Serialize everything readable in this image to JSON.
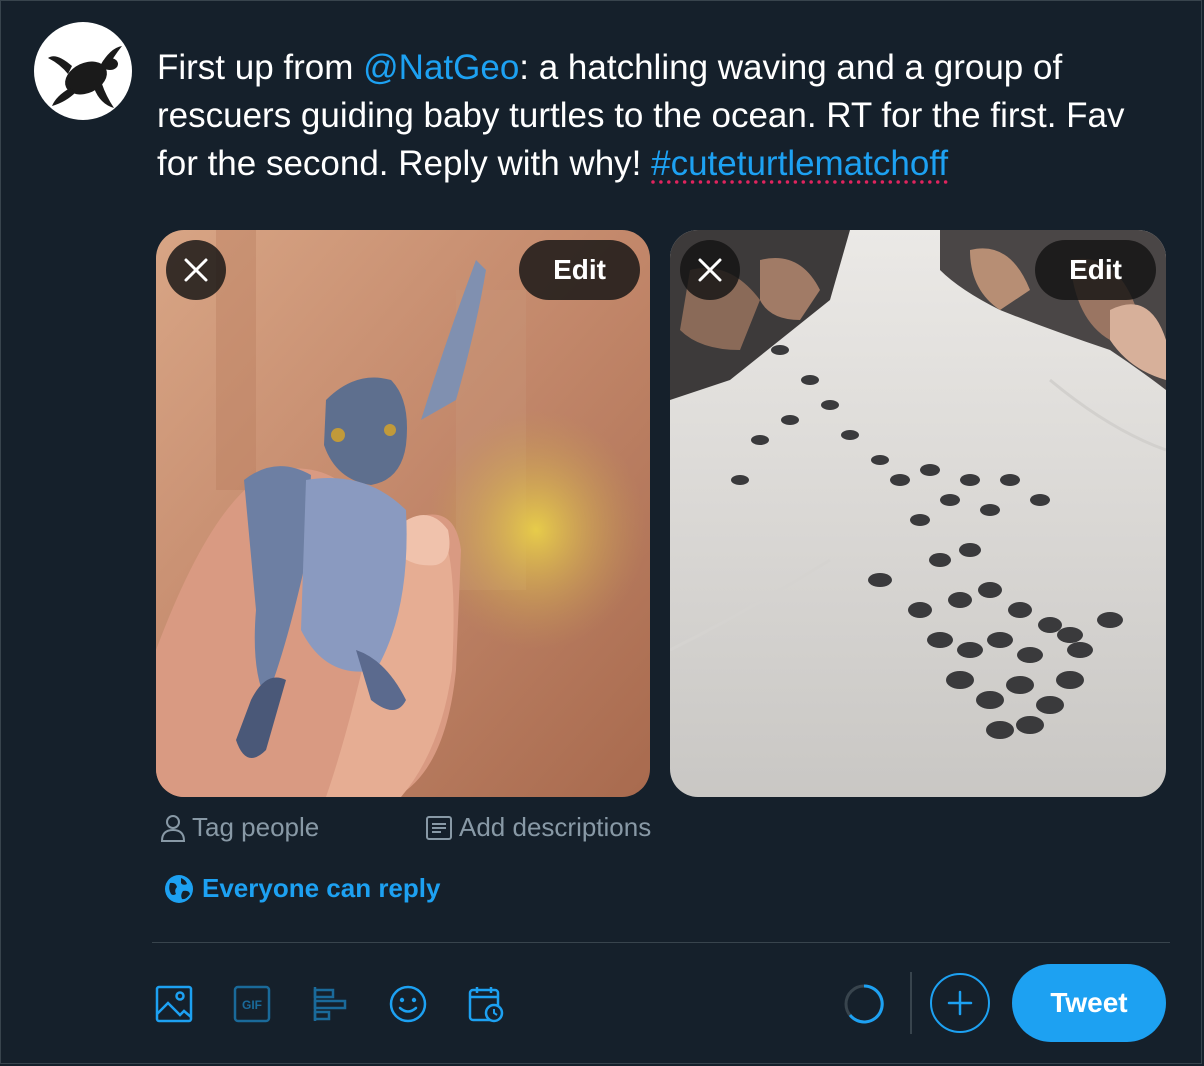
{
  "composer": {
    "text_prefix": "First up from ",
    "mention": "@NatGeo",
    "text_body": ": a hatchling waving and a group of rescuers guiding baby turtles to the ocean. RT for the first. Fav for the second. Reply with why! ",
    "hashtag": "#cuteturtlematchoff"
  },
  "media": {
    "edit_label": "Edit",
    "tag_people_label": "Tag people",
    "add_descriptions_label": "Add descriptions"
  },
  "reply_setting": {
    "label": "Everyone can reply"
  },
  "toolbar": {
    "icons": [
      "image-icon",
      "gif-icon",
      "poll-icon",
      "emoji-icon",
      "schedule-icon"
    ],
    "gif_label": "GIF",
    "tweet_label": "Tweet"
  },
  "colors": {
    "background": "#15202b",
    "accent": "#1da1f2",
    "muted": "#8899a6",
    "border": "#38444d"
  }
}
